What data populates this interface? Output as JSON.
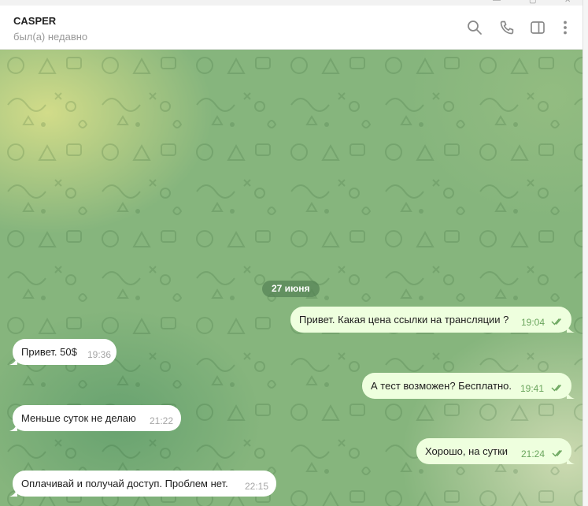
{
  "header": {
    "title": "CASPER",
    "status": "был(а) недавно",
    "icons": [
      "search-icon",
      "phone-icon",
      "sidebar-toggle-icon",
      "more-vertical-icon"
    ]
  },
  "window_controls": [
    "minimize-icon",
    "maximize-icon",
    "close-icon"
  ],
  "colors": {
    "header_bg": "#ffffff",
    "incoming_bubble": "#ffffff",
    "outgoing_bubble": "#eeffde",
    "time_out": "#6aa55d",
    "time_in": "#a5a5a5",
    "date_badge": "#548254",
    "icon_gray": "#8a8a8a"
  },
  "chat": {
    "date_separator": "27 июня",
    "messages": [
      {
        "direction": "out",
        "text": "Привет. Какая цена ссылки на трансляции ?",
        "time": "19:04",
        "read": true
      },
      {
        "direction": "in",
        "text": "Привет. 50$",
        "time": "19:36"
      },
      {
        "direction": "out",
        "text": "А тест возможен? Бесплатно.",
        "time": "19:41",
        "read": true
      },
      {
        "direction": "in",
        "text": "Меньше суток не делаю",
        "time": "21:22"
      },
      {
        "direction": "out",
        "text": "Хорошо, на сутки",
        "time": "21:24",
        "read": true
      },
      {
        "direction": "in",
        "text": "Оплачивай и получай доступ. Проблем нет.",
        "time": "22:15"
      }
    ]
  }
}
